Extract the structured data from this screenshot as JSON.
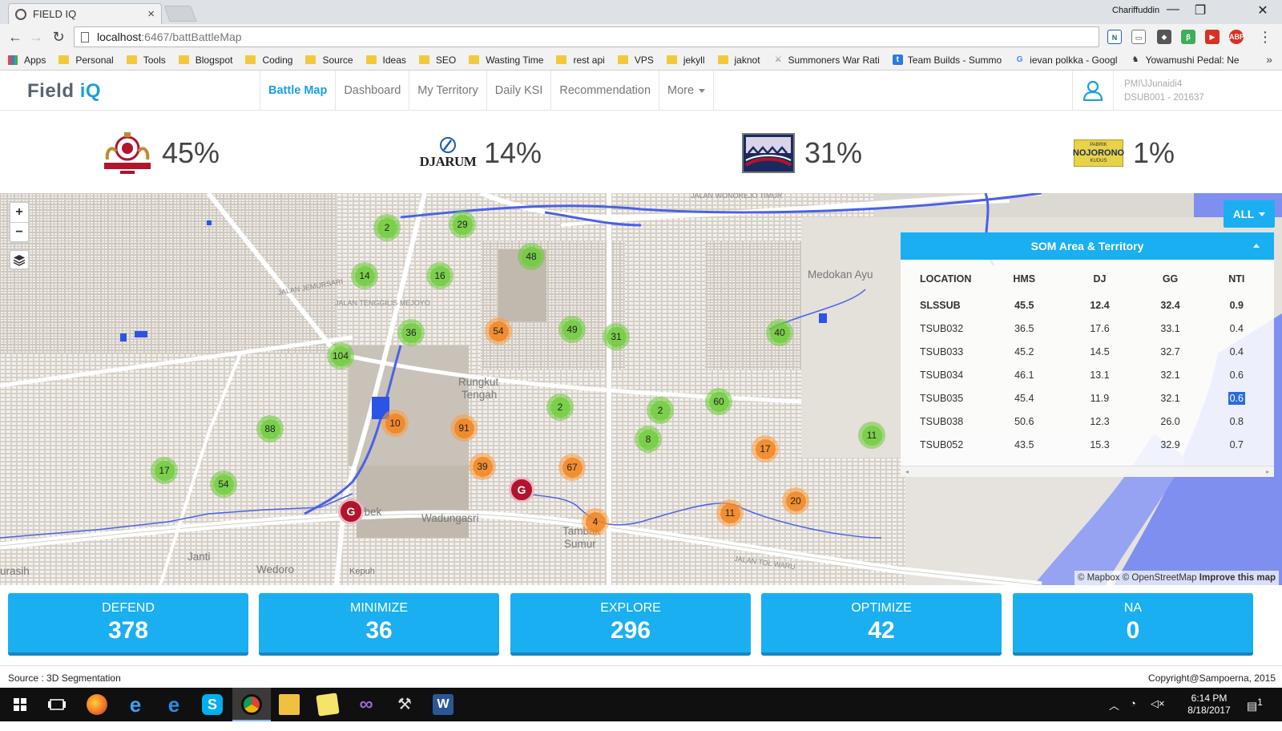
{
  "browser": {
    "tab_title": "FIELD IQ",
    "tab_close": "×",
    "user": "Chariffuddin",
    "controls": {
      "minimize": "—",
      "restore": "❐",
      "close": "✕"
    },
    "url_host": "localhost",
    "url_path": ":6467/battBattleMap",
    "bookmarks": [
      {
        "label": "Apps",
        "type": "apps"
      },
      {
        "label": "Personal",
        "type": "folder"
      },
      {
        "label": "Tools",
        "type": "folder"
      },
      {
        "label": "Blogspot",
        "type": "folder"
      },
      {
        "label": "Coding",
        "type": "folder"
      },
      {
        "label": "Source",
        "type": "folder"
      },
      {
        "label": "Ideas",
        "type": "folder"
      },
      {
        "label": "SEO",
        "type": "folder"
      },
      {
        "label": "Wasting Time",
        "type": "folder"
      },
      {
        "label": "rest api",
        "type": "folder"
      },
      {
        "label": "VPS",
        "type": "folder"
      },
      {
        "label": "jekyll",
        "type": "folder"
      },
      {
        "label": "jaknot",
        "type": "folder"
      },
      {
        "label": "Summoners War Rati",
        "type": "page"
      },
      {
        "label": "Team Builds - Summo",
        "type": "page"
      },
      {
        "label": "ievan polkka - Googl",
        "type": "google"
      },
      {
        "label": "Yowamushi Pedal: Ne",
        "type": "page"
      }
    ],
    "bookmarks_more": "»"
  },
  "app": {
    "logo_main": "Field",
    "logo_accent": "iQ",
    "nav": [
      "Battle Map",
      "Dashboard",
      "My Territory",
      "Daily KSI",
      "Recommendation",
      "More"
    ],
    "user_line1": "PMI\\JJunaidi4",
    "user_line2": "DSUB001 - 201637"
  },
  "shares": [
    {
      "brand": "sampoerna-logo",
      "pct": "45%"
    },
    {
      "brand": "djarum-logo",
      "pct": "14%",
      "logo_text": "DJARUM"
    },
    {
      "brand": "gudang-garam-logo",
      "pct": "31%"
    },
    {
      "brand": "nojorono-logo",
      "pct": "1%",
      "logo_text": "NOJORONO",
      "logo_top": "PABRIK",
      "logo_bottom": "KUDUS"
    }
  ],
  "map": {
    "all_button": "ALL",
    "zoom_in": "+",
    "zoom_out": "−",
    "attribution_1": "© Mapbox © OpenStreetMap",
    "attribution_link": "Improve this map",
    "places": [
      {
        "name": "Medokan Ayu"
      },
      {
        "name": "Rungkut"
      },
      {
        "name": "Tengah"
      },
      {
        "name": "Wadungasri"
      },
      {
        "name": "Tambak"
      },
      {
        "name": "Sumur"
      },
      {
        "name": "rbek"
      },
      {
        "name": "Janti"
      },
      {
        "name": "Wedoro"
      },
      {
        "name": "urasih"
      },
      {
        "name": "Kepuh"
      }
    ],
    "roads": [
      {
        "name": "JALAN WONOREJO TIMUR"
      },
      {
        "name": "JALAN TENGGILIS MEJOYO"
      },
      {
        "name": "JALAN JEMURSARI"
      },
      {
        "name": "JALAN TOL WARU"
      }
    ],
    "clusters": [
      {
        "n": "2",
        "c": "green"
      },
      {
        "n": "29",
        "c": "green"
      },
      {
        "n": "48",
        "c": "green"
      },
      {
        "n": "14",
        "c": "green"
      },
      {
        "n": "16",
        "c": "green"
      },
      {
        "n": "36",
        "c": "green"
      },
      {
        "n": "54",
        "c": "orange"
      },
      {
        "n": "49",
        "c": "green"
      },
      {
        "n": "31",
        "c": "green"
      },
      {
        "n": "40",
        "c": "green"
      },
      {
        "n": "104",
        "c": "green"
      },
      {
        "n": "2",
        "c": "green"
      },
      {
        "n": "2",
        "c": "green"
      },
      {
        "n": "60",
        "c": "green"
      },
      {
        "n": "88",
        "c": "green"
      },
      {
        "n": "10",
        "c": "orange"
      },
      {
        "n": "91",
        "c": "orange"
      },
      {
        "n": "8",
        "c": "green"
      },
      {
        "n": "17",
        "c": "orange"
      },
      {
        "n": "11",
        "c": "green"
      },
      {
        "n": "17",
        "c": "green"
      },
      {
        "n": "54",
        "c": "green"
      },
      {
        "n": "39",
        "c": "orange"
      },
      {
        "n": "67",
        "c": "orange"
      },
      {
        "n": "20",
        "c": "orange"
      },
      {
        "n": "11",
        "c": "orange"
      },
      {
        "n": "4",
        "c": "orange"
      }
    ],
    "g_markers": [
      "G",
      "G"
    ]
  },
  "som": {
    "title": "SOM Area & Territory",
    "columns": [
      "LOCATION",
      "HMS",
      "DJ",
      "GG",
      "NTI"
    ],
    "rows": [
      [
        "SLSSUB",
        "45.5",
        "12.4",
        "32.4",
        "0.9"
      ],
      [
        "TSUB032",
        "36.5",
        "17.6",
        "33.1",
        "0.4"
      ],
      [
        "TSUB033",
        "45.2",
        "14.5",
        "32.7",
        "0.4"
      ],
      [
        "TSUB034",
        "46.1",
        "13.1",
        "32.1",
        "0.6"
      ],
      [
        "TSUB035",
        "45.4",
        "11.9",
        "32.1",
        "0.6"
      ],
      [
        "TSUB038",
        "50.6",
        "12.3",
        "26.0",
        "0.8"
      ],
      [
        "TSUB052",
        "43.5",
        "15.3",
        "32.9",
        "0.7"
      ]
    ],
    "scroll_left": "◂",
    "scroll_right": "▸"
  },
  "cards": [
    {
      "label": "DEFEND",
      "value": "378"
    },
    {
      "label": "MINIMIZE",
      "value": "36"
    },
    {
      "label": "EXPLORE",
      "value": "296"
    },
    {
      "label": "OPTIMIZE",
      "value": "42"
    },
    {
      "label": "NA",
      "value": "0"
    }
  ],
  "footer": {
    "source": "Source : 3D Segmentation",
    "copyright": "Copyright@Sampoerna, 2015"
  },
  "taskbar": {
    "time": "6:14 PM",
    "date": "8/18/2017",
    "notifications": "1"
  },
  "colors": {
    "accent": "#1aaff0",
    "cluster_green": "#6ecc39",
    "cluster_orange": "#f18017",
    "marker_red": "#b3132b"
  }
}
